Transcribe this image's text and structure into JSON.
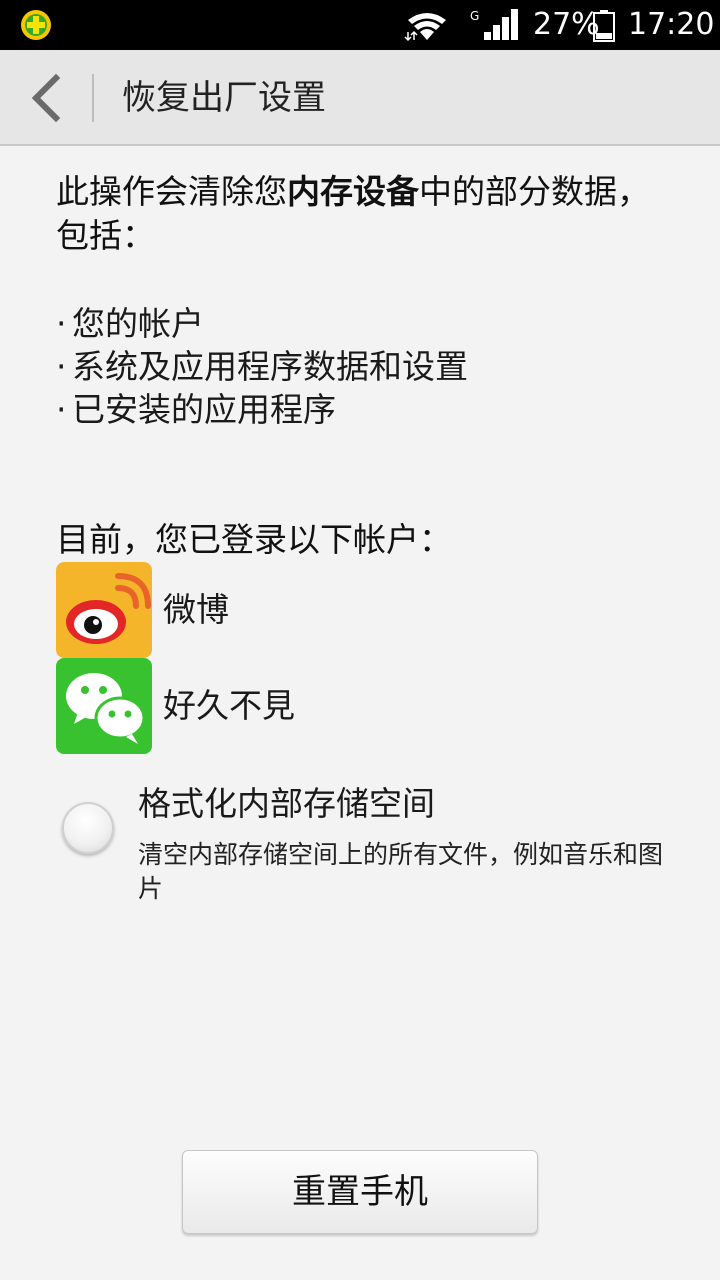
{
  "status_bar": {
    "network_type": "G",
    "battery": "27%",
    "time": "17:20",
    "icons": [
      "app-notification-icon",
      "wifi-icon",
      "signal-icon",
      "battery-icon"
    ]
  },
  "action_bar": {
    "title": "恢复出厂设置",
    "back_icon": "chevron-left-icon"
  },
  "intro": {
    "before": "此操作会清除您",
    "bold": "内存设备",
    "after": "中的部分数据，包括："
  },
  "bullets": [
    "您的帐户",
    "系统及应用程序数据和设置",
    "已安装的应用程序"
  ],
  "accounts": {
    "title": "目前，您已登录以下帐户：",
    "items": [
      {
        "name": "微博",
        "icon": "weibo-icon",
        "color": "#f5b52a"
      },
      {
        "name": "好久不見",
        "icon": "wechat-icon",
        "color": "#38c22f"
      }
    ]
  },
  "format_option": {
    "title": "格式化内部存储空间",
    "description": "清空内部存储空间上的所有文件，例如音乐和图片",
    "checked": false
  },
  "reset_button": {
    "label": "重置手机"
  }
}
